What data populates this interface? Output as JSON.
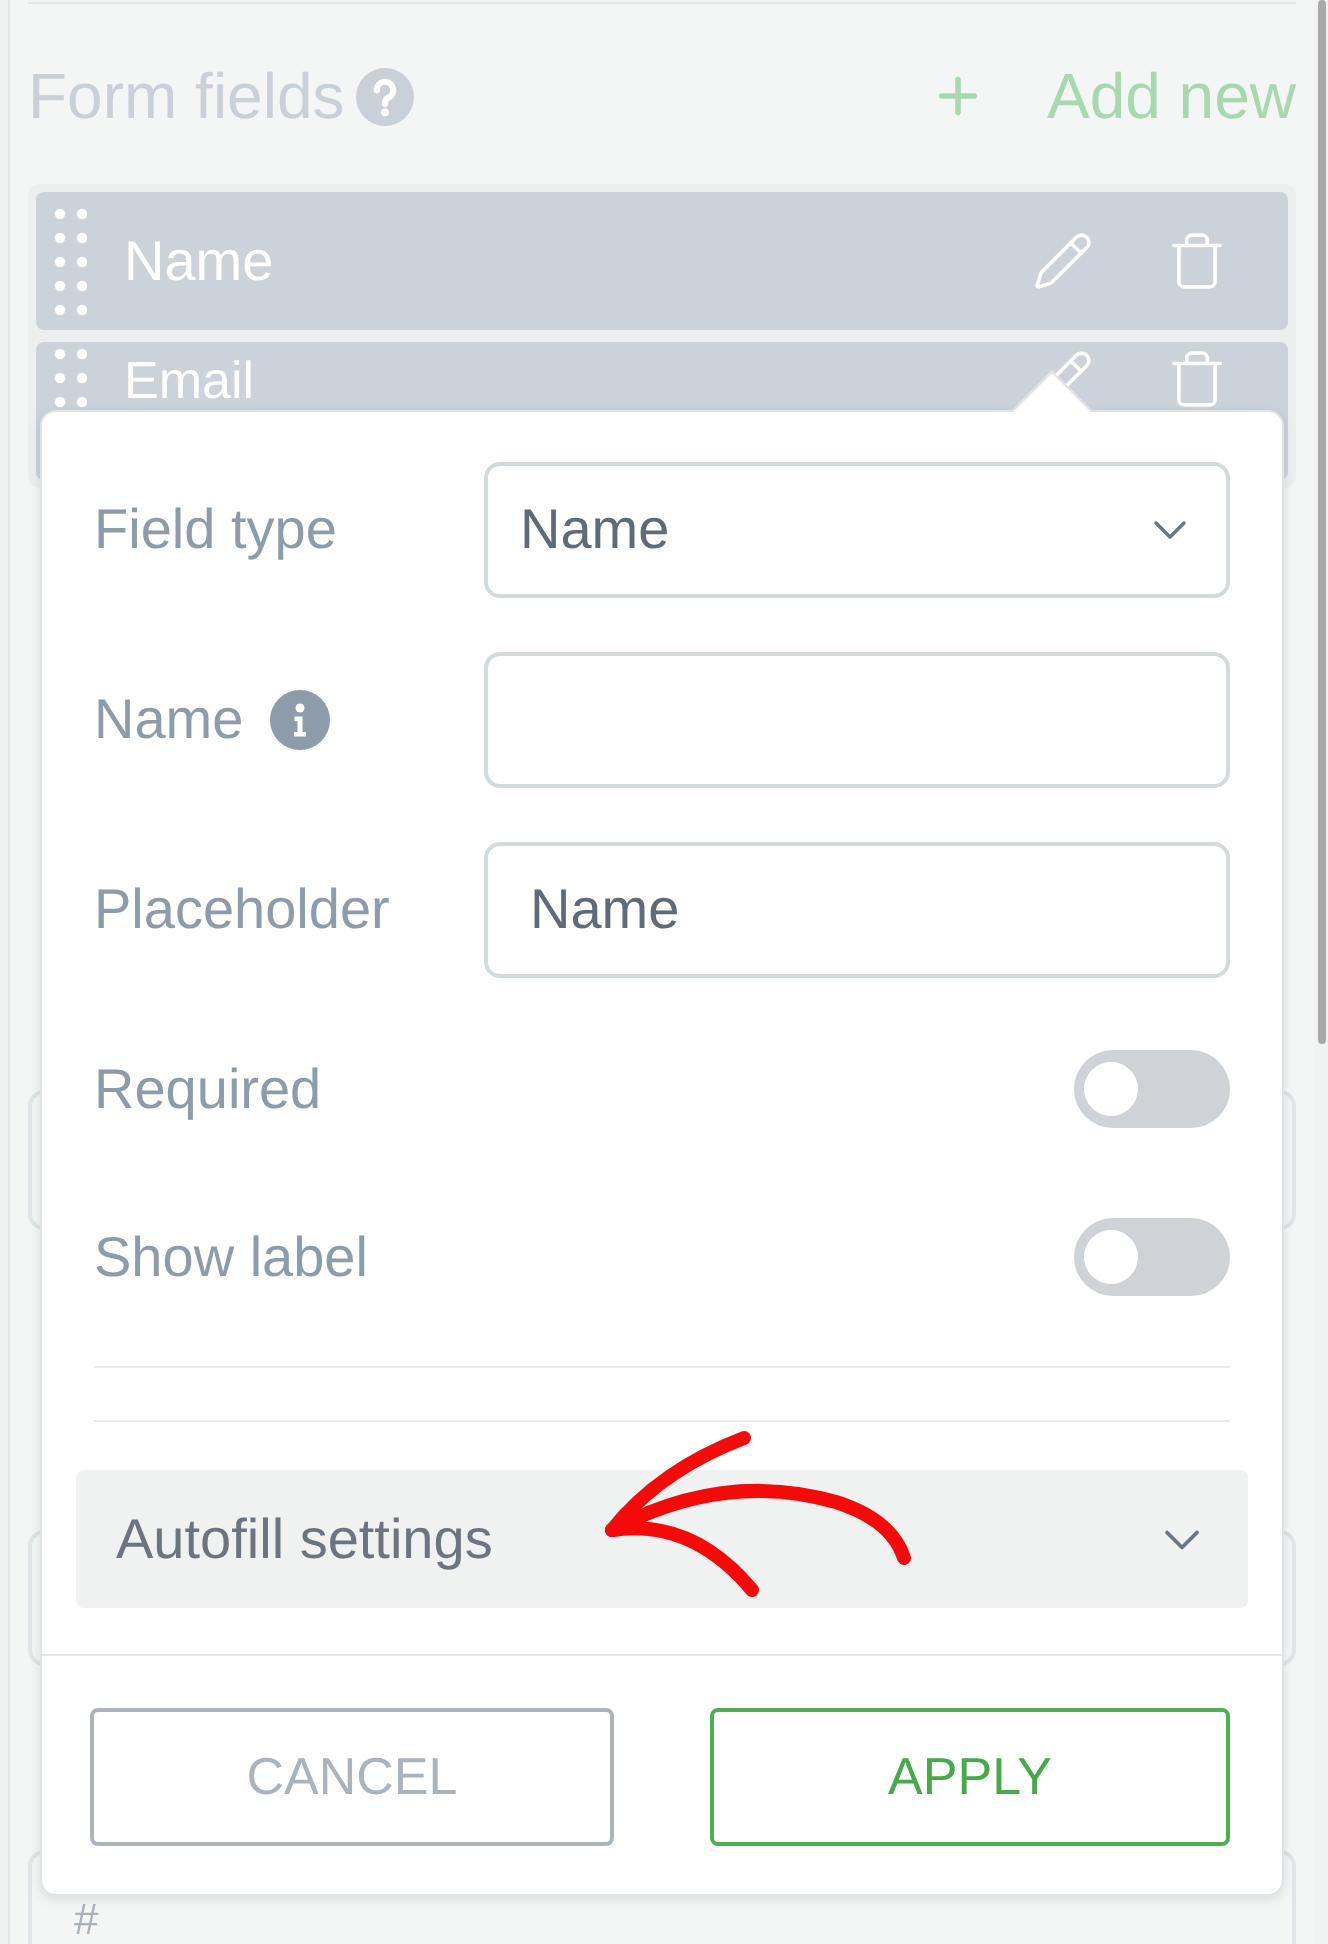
{
  "panel": {
    "title": "Form fields",
    "add_button": {
      "label": "Add new"
    }
  },
  "form_fields": [
    {
      "label": "Name"
    },
    {
      "label": "Email"
    }
  ],
  "background_field": {
    "prefix": "#"
  },
  "field_editor": {
    "settings": [
      {
        "kind": "select",
        "label": "Field type",
        "value": "Name",
        "info": false
      },
      {
        "kind": "text",
        "label": "Name",
        "info": true
      },
      {
        "kind": "text",
        "label": "Placeholder",
        "value": "Name",
        "info": false
      },
      {
        "kind": "toggle",
        "label": "Required",
        "on": false,
        "info": false
      },
      {
        "kind": "toggle",
        "label": "Show label",
        "on": false,
        "info": false
      }
    ],
    "autofill_section": {
      "label": "Autofill settings",
      "expanded": false
    },
    "buttons": [
      {
        "kind": "secondary",
        "label": "CANCEL"
      },
      {
        "kind": "primary",
        "label": "APPLY"
      }
    ]
  }
}
